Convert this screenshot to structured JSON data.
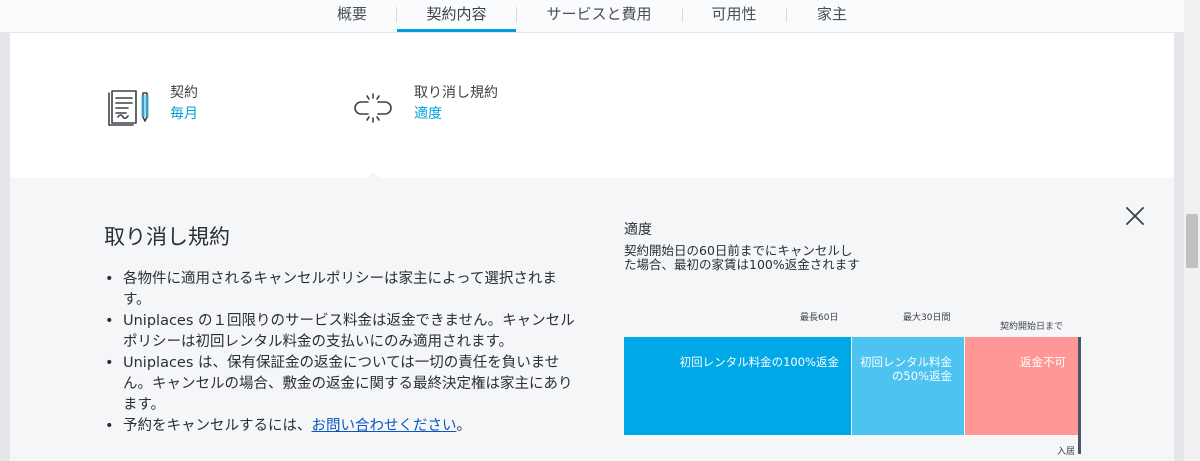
{
  "tabs": [
    {
      "label": "概要"
    },
    {
      "label": "契約内容"
    },
    {
      "label": "サービスと費用"
    },
    {
      "label": "可用性"
    },
    {
      "label": "家主"
    }
  ],
  "summary": {
    "contract": {
      "label": "契約",
      "value": "毎月",
      "icon": "contract-document-icon"
    },
    "cancellation": {
      "label": "取り消し規約",
      "value": "適度",
      "icon": "broken-link-icon"
    }
  },
  "panel": {
    "title": "取り消し規約",
    "bullets": {
      "b1": "各物件に適用されるキャンセルポリシーは家主によって選択されます。",
      "b2": "Uniplaces の１回限りのサービス料金は返金できません。キャンセルポリシーは初回レンタル料金の支払いにのみ適用されます。",
      "b3": "Uniplaces は、保有保証金の返金については一切の責任を負いません。キャンセルの場合、敷金の返金に関する最終決定権は家主にあります。",
      "b4_prefix": "予約をキャンセルするには、",
      "b4_link": "お問い合わせください",
      "b4_suffix": "。"
    },
    "policy": {
      "name": "適度",
      "description": "契約開始日の60日前までにキャンセルした場合、最初の家賃は100%返金されます"
    },
    "timeline": {
      "labels": {
        "l1": "最長60日",
        "l2": "最大30日間",
        "l3": "契約開始日まで",
        "move_in": "入居"
      },
      "segments": [
        {
          "text": "初回レンタル料金の100%返金",
          "color": "#00a8e8"
        },
        {
          "text": "初回レンタル料金の50%返金",
          "color": "#4cc3f0"
        },
        {
          "text": "返金不可",
          "color": "#ff9797"
        }
      ]
    }
  },
  "colors": {
    "accent": "#00a0dd",
    "link": "#0a56c2"
  }
}
